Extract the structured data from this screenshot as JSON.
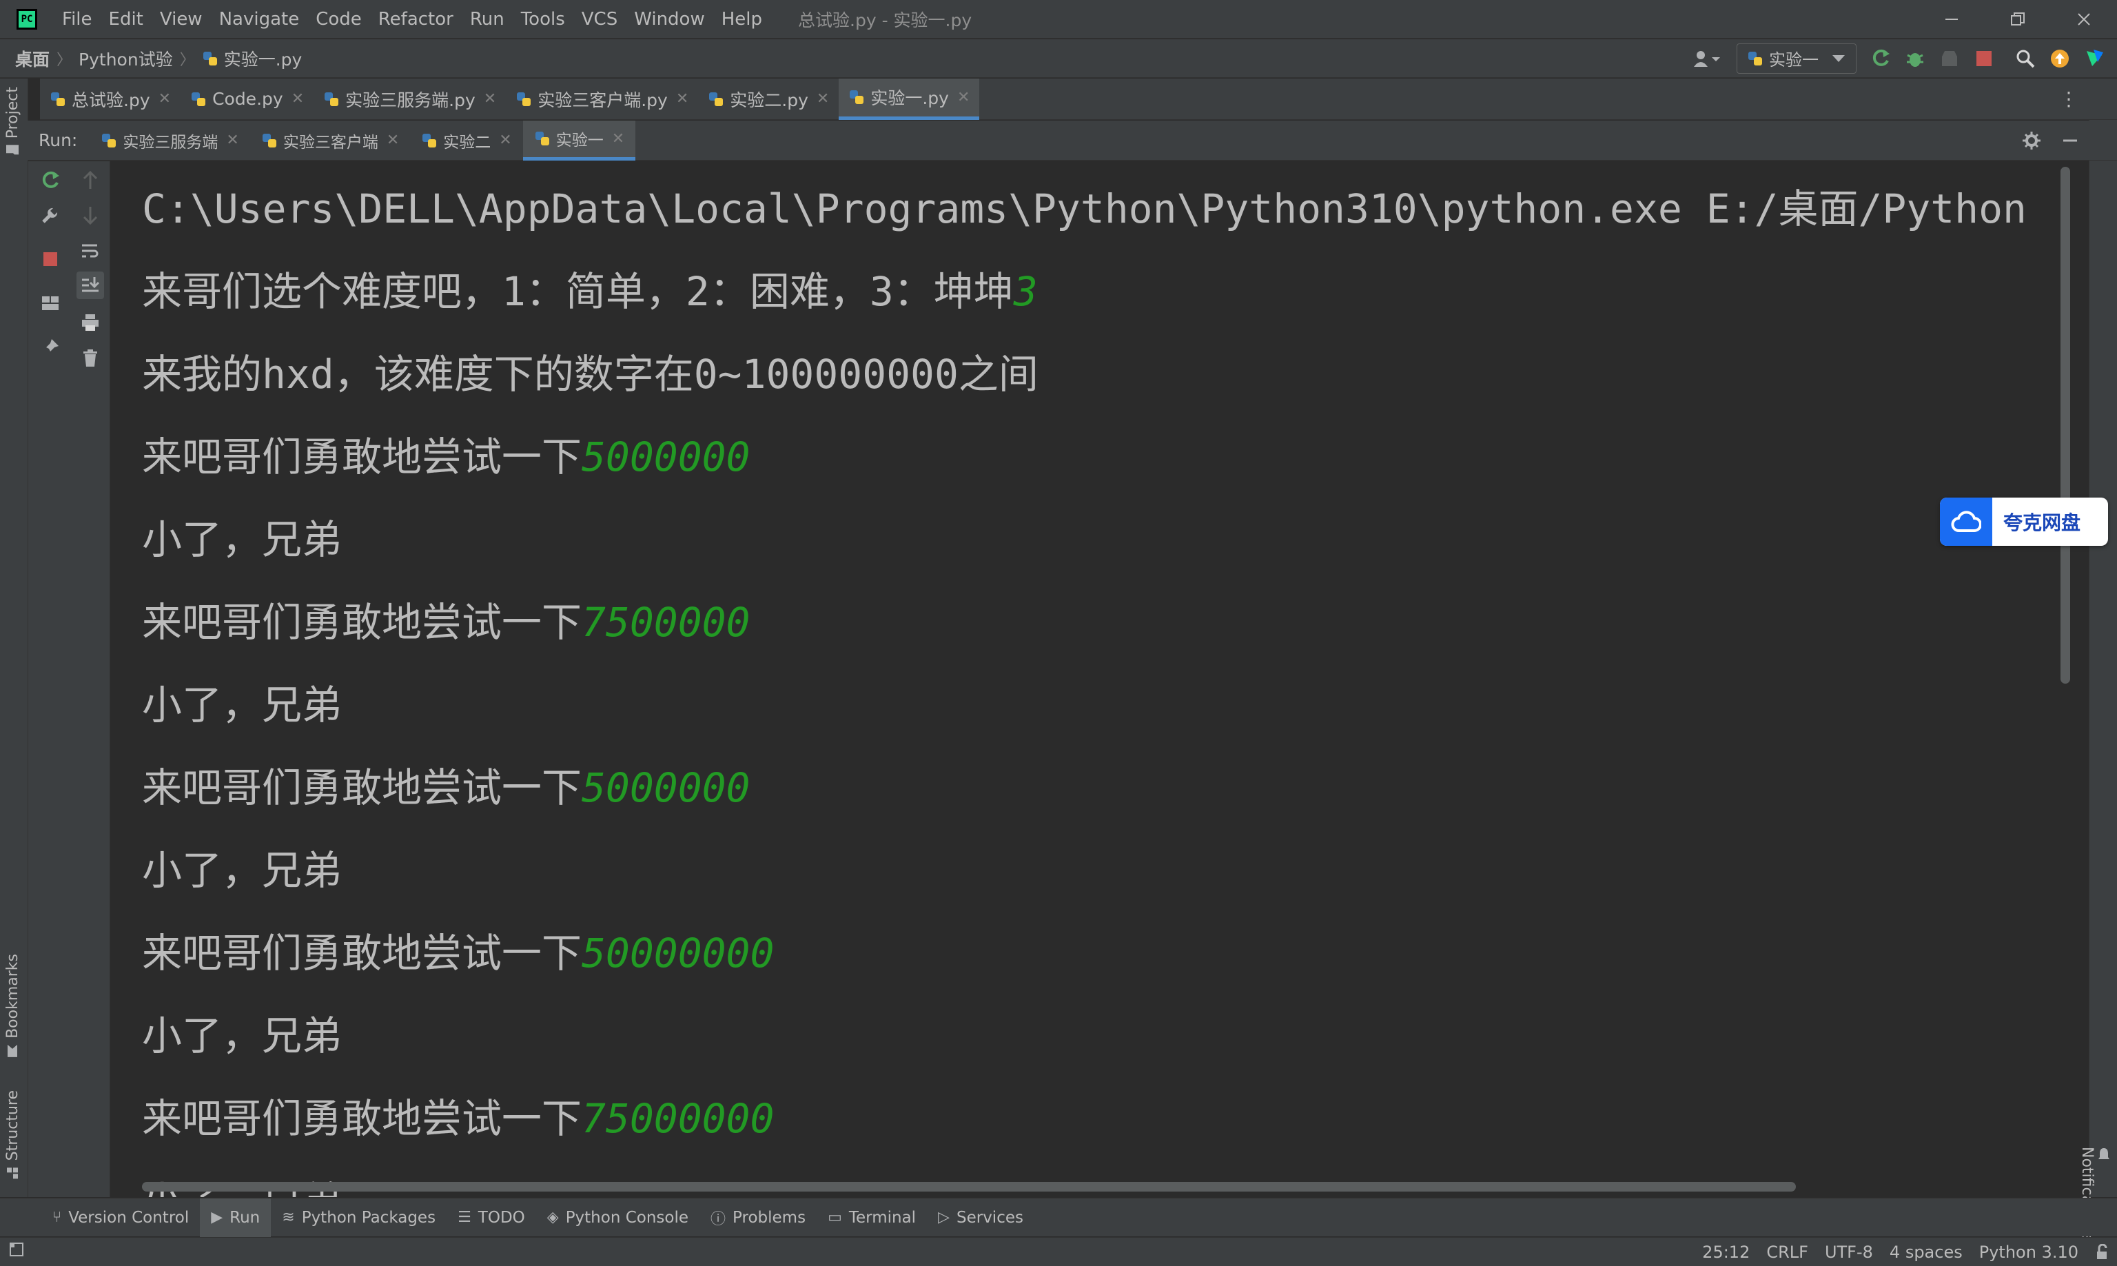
{
  "titlebar": {
    "menu": [
      "File",
      "Edit",
      "View",
      "Navigate",
      "Code",
      "Refactor",
      "Run",
      "Tools",
      "VCS",
      "Window",
      "Help"
    ],
    "window_title": "总试验.py - 实验一.py"
  },
  "navbar": {
    "breadcrumbs": [
      "桌面",
      "Python试验",
      "实验一.py"
    ],
    "run_config": "实验一"
  },
  "editor_tabs": [
    {
      "label": "总试验.py"
    },
    {
      "label": "Code.py"
    },
    {
      "label": "实验三服务端.py"
    },
    {
      "label": "实验三客户端.py"
    },
    {
      "label": "实验二.py"
    },
    {
      "label": "实验一.py"
    }
  ],
  "run": {
    "label": "Run:",
    "tabs": [
      {
        "label": "实验三服务端"
      },
      {
        "label": "实验三客户端"
      },
      {
        "label": "实验二"
      },
      {
        "label": "实验一"
      }
    ]
  },
  "left_stripe": {
    "project": "Project",
    "bookmarks": "Bookmarks",
    "structure": "Structure"
  },
  "right_stripe": {
    "notifications": "Notifications"
  },
  "console": {
    "command": "C:\\Users\\DELL\\AppData\\Local\\Programs\\Python\\Python310\\python.exe E:/桌面/Python",
    "lines": [
      {
        "text": "来哥们选个难度吧，1：简单，2：困难，3：坤坤",
        "input": "3"
      },
      {
        "text": "来我的hxd，该难度下的数字在0~100000000之间",
        "input": ""
      },
      {
        "text": "来吧哥们勇敢地尝试一下",
        "input": "5000000"
      },
      {
        "text": "小了，兄弟",
        "input": ""
      },
      {
        "text": "来吧哥们勇敢地尝试一下",
        "input": "7500000"
      },
      {
        "text": "小了，兄弟",
        "input": ""
      },
      {
        "text": "来吧哥们勇敢地尝试一下",
        "input": "5000000"
      },
      {
        "text": "小了，兄弟",
        "input": ""
      },
      {
        "text": "来吧哥们勇敢地尝试一下",
        "input": "50000000"
      },
      {
        "text": "小了，兄弟",
        "input": ""
      },
      {
        "text": "来吧哥们勇敢地尝试一下",
        "input": "75000000"
      },
      {
        "text": "小了，兄弟",
        "input": ""
      }
    ],
    "input_color": "#229a24"
  },
  "quark": {
    "label": "夸克网盘"
  },
  "toolwindows": [
    {
      "label": "Version Control"
    },
    {
      "label": "Run"
    },
    {
      "label": "Python Packages"
    },
    {
      "label": "TODO"
    },
    {
      "label": "Python Console"
    },
    {
      "label": "Problems"
    },
    {
      "label": "Terminal"
    },
    {
      "label": "Services"
    }
  ],
  "status": {
    "position": "25:12",
    "line_sep": "CRLF",
    "encoding": "UTF-8",
    "indent": "4 spaces",
    "interpreter": "Python 3.10"
  },
  "colors": {
    "accent": "#4a88c7",
    "background": "#2b2b2b",
    "panel": "#3c3f41"
  }
}
